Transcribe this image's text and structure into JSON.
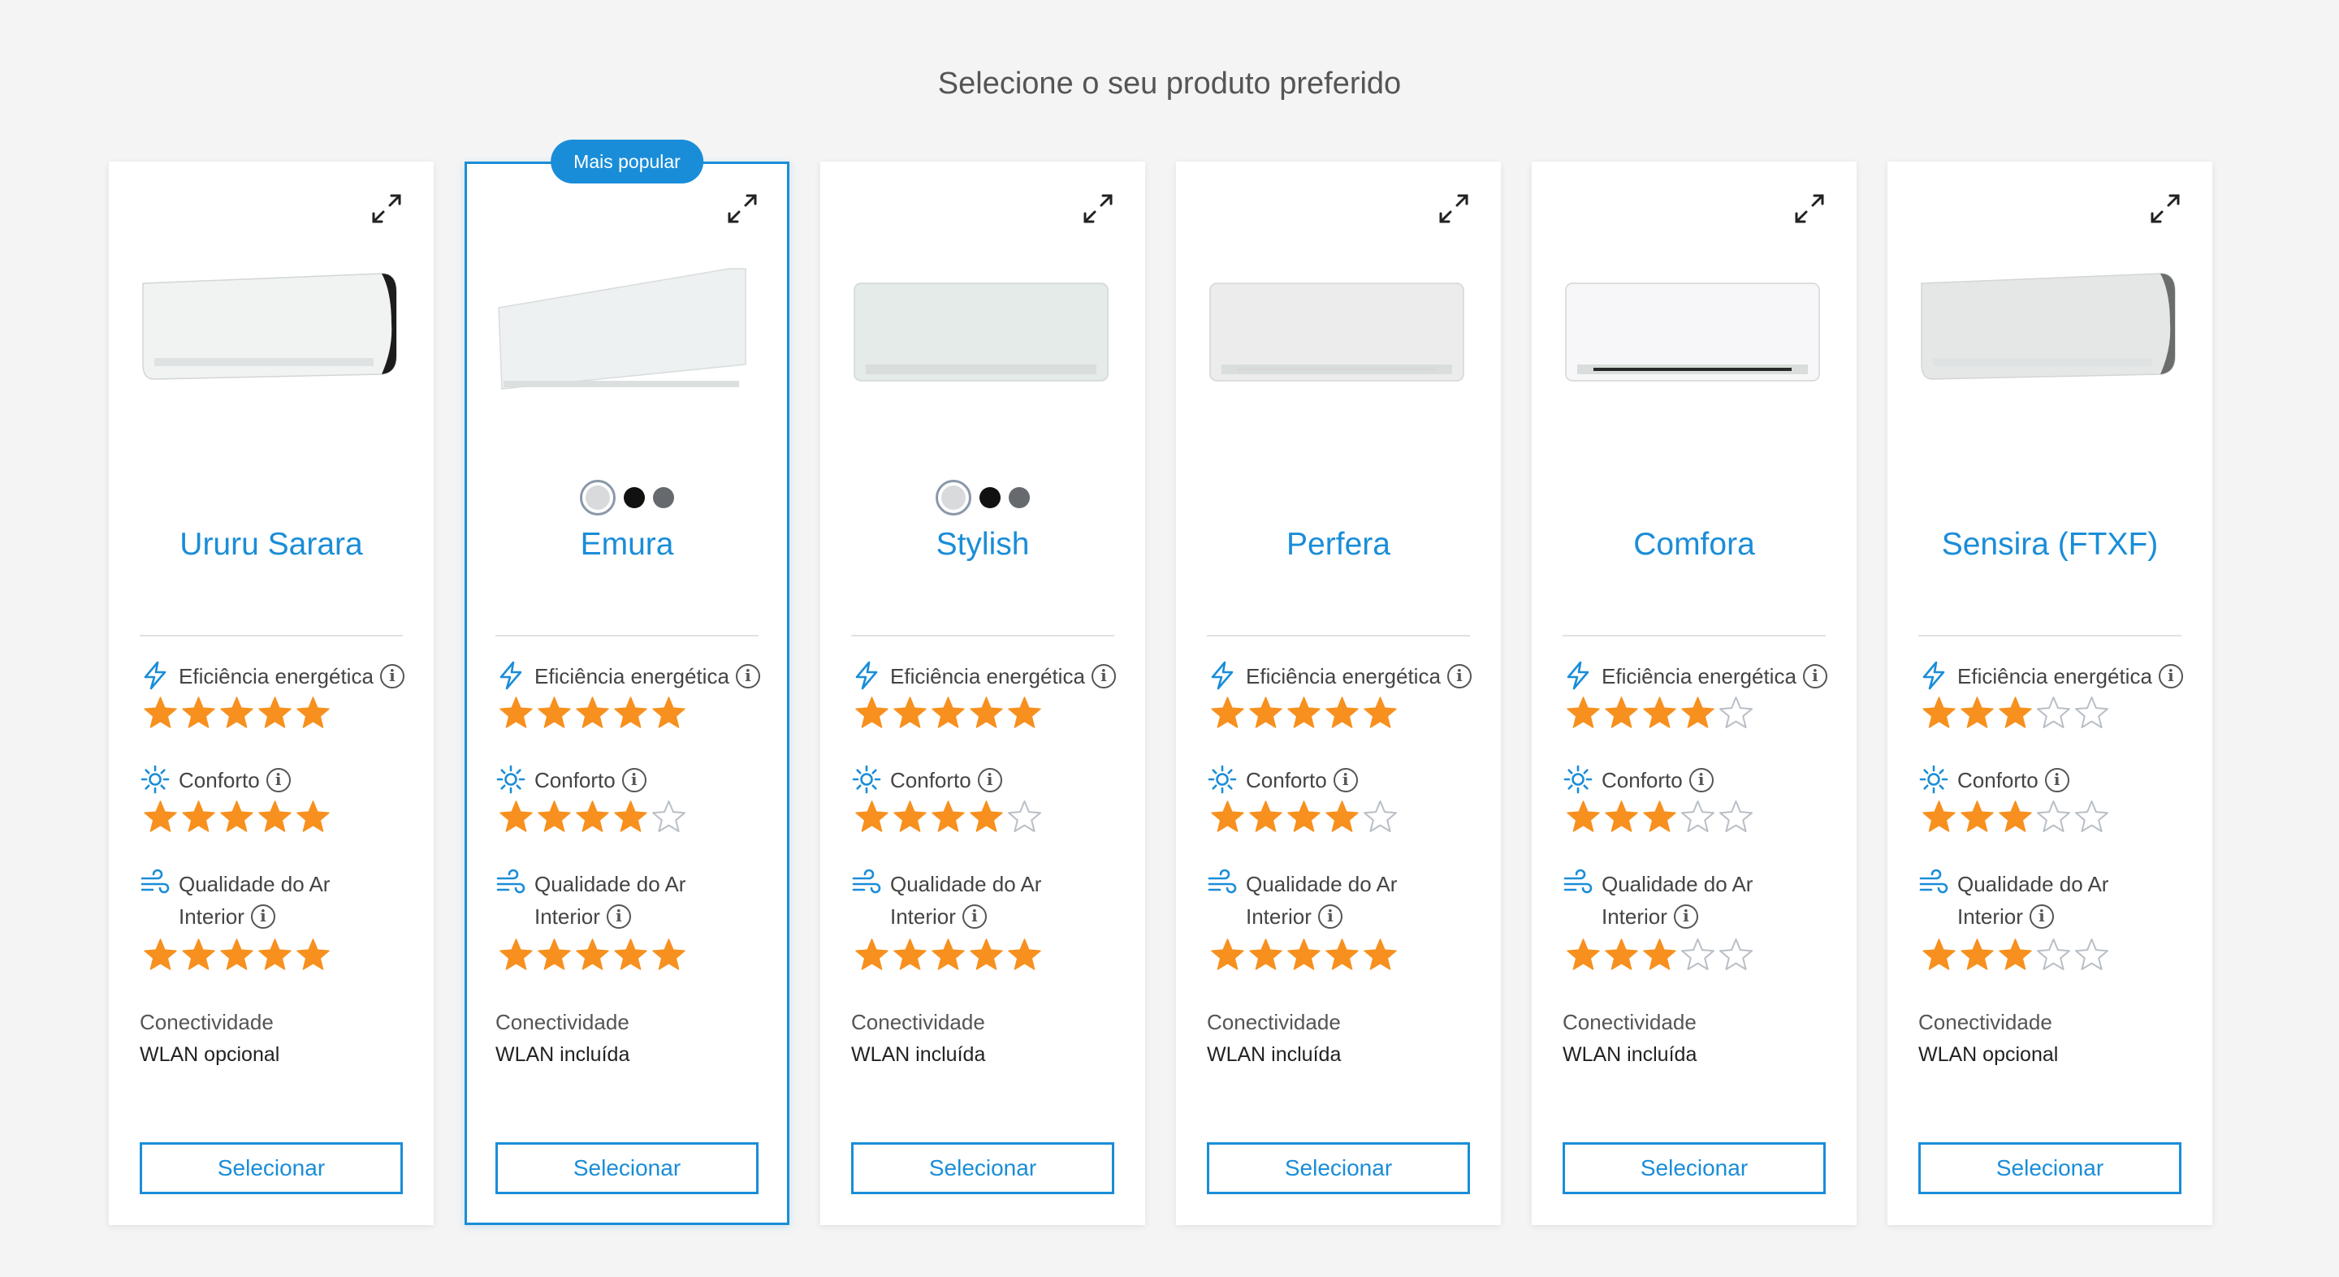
{
  "page": {
    "title": "Selecione o seu produto preferido"
  },
  "colors": {
    "accent": "#1a8dd8",
    "star_filled": "#f7901e",
    "star_empty": "#b9bfc6"
  },
  "labels": {
    "efficiency": "Eficiência energética",
    "comfort": "Conforto",
    "air_quality": "Qualidade do Ar Interior",
    "connectivity": "Conectividade",
    "select": "Selecionar",
    "info_icon": "info-icon"
  },
  "products": [
    {
      "name": "Ururu Sarara",
      "badge": "",
      "swatches": [],
      "ratings": {
        "efficiency": 5,
        "comfort": 5,
        "air_quality": 5
      },
      "connectivity": "WLAN opcional"
    },
    {
      "name": "Emura",
      "badge": "Mais popular",
      "swatches": [
        "white",
        "black",
        "silver"
      ],
      "ratings": {
        "efficiency": 5,
        "comfort": 4,
        "air_quality": 5
      },
      "connectivity": "WLAN incluída"
    },
    {
      "name": "Stylish",
      "badge": "",
      "swatches": [
        "white",
        "black",
        "silver"
      ],
      "ratings": {
        "efficiency": 5,
        "comfort": 4,
        "air_quality": 5
      },
      "connectivity": "WLAN incluída"
    },
    {
      "name": "Perfera",
      "badge": "",
      "swatches": [],
      "ratings": {
        "efficiency": 5,
        "comfort": 4,
        "air_quality": 5
      },
      "connectivity": "WLAN incluída"
    },
    {
      "name": "Comfora",
      "badge": "",
      "swatches": [],
      "ratings": {
        "efficiency": 4,
        "comfort": 3,
        "air_quality": 3
      },
      "connectivity": "WLAN incluída"
    },
    {
      "name": "Sensira (FTXF)",
      "badge": "",
      "swatches": [],
      "ratings": {
        "efficiency": 3,
        "comfort": 3,
        "air_quality": 3
      },
      "connectivity": "WLAN opcional"
    }
  ]
}
